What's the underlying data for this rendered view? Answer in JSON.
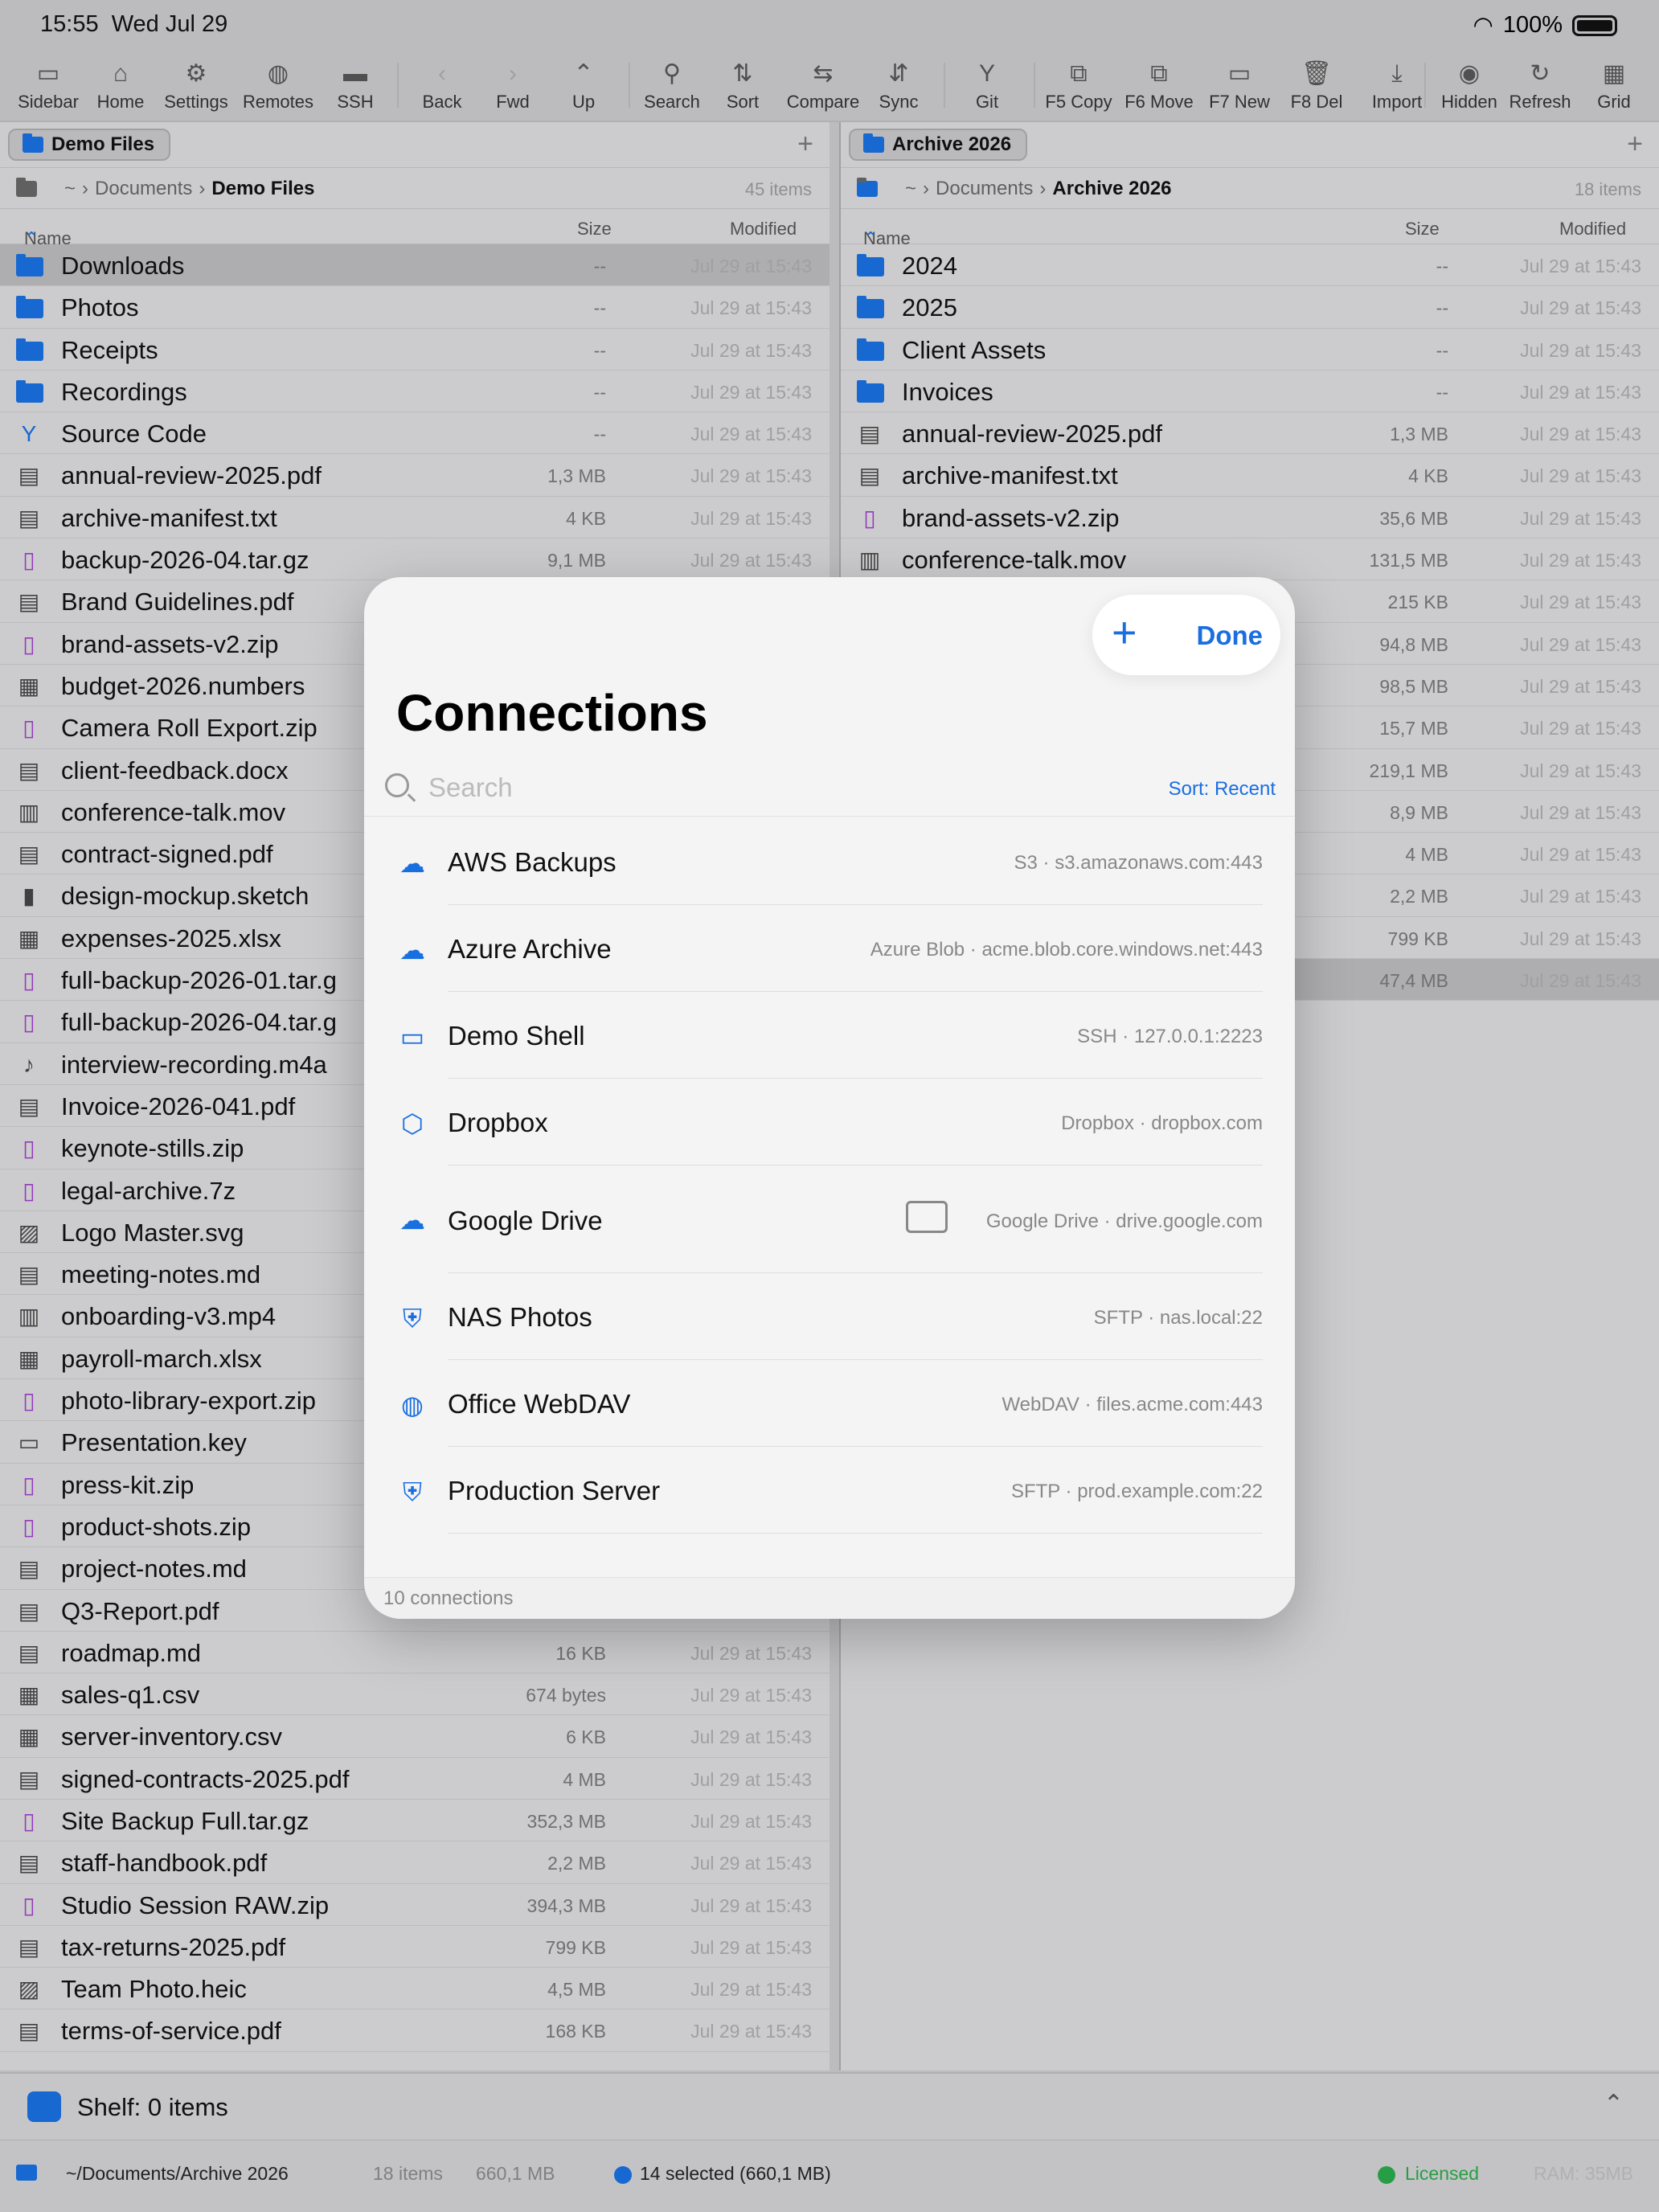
{
  "status": {
    "time": "15:55",
    "date": "Wed Jul 29",
    "battery": "100%"
  },
  "toolbar": [
    {
      "label": "Sidebar",
      "icon": "sidebar-icon",
      "glyph": "▭"
    },
    {
      "label": "Home",
      "icon": "home-icon",
      "glyph": "⌂"
    },
    {
      "label": "Settings",
      "icon": "gear-icon",
      "glyph": "⚙"
    },
    {
      "label": "Remotes",
      "icon": "globe-icon",
      "glyph": "◍"
    },
    {
      "label": "SSH",
      "icon": "terminal-icon",
      "glyph": "▬"
    },
    {
      "label": "Back",
      "icon": "back-icon",
      "glyph": "‹"
    },
    {
      "label": "Fwd",
      "icon": "forward-icon",
      "glyph": "›"
    },
    {
      "label": "Up",
      "icon": "up-icon",
      "glyph": "⌃"
    },
    {
      "label": "Search",
      "icon": "search-icon",
      "glyph": "⚲"
    },
    {
      "label": "Sort",
      "icon": "sort-icon",
      "glyph": "⇅"
    },
    {
      "label": "Compare",
      "icon": "compare-icon",
      "glyph": "⇆"
    },
    {
      "label": "Sync",
      "icon": "sync-icon",
      "glyph": "⇵"
    },
    {
      "label": "Git",
      "icon": "git-icon",
      "glyph": "Y"
    },
    {
      "label": "F5 Copy",
      "icon": "copy-icon",
      "glyph": "⧉"
    },
    {
      "label": "F6 Move",
      "icon": "move-icon",
      "glyph": "⧉"
    },
    {
      "label": "F7 New",
      "icon": "new-folder-icon",
      "glyph": "▭"
    },
    {
      "label": "F8 Del",
      "icon": "trash-icon",
      "glyph": "🗑"
    },
    {
      "label": "Import",
      "icon": "import-icon",
      "glyph": "⤓"
    },
    {
      "label": "Hidden",
      "icon": "eye-slash-icon",
      "glyph": "◉"
    },
    {
      "label": "Refresh",
      "icon": "refresh-icon",
      "glyph": "↻"
    },
    {
      "label": "Grid",
      "icon": "grid-icon",
      "glyph": "▦"
    }
  ],
  "left": {
    "tab": "Demo Files",
    "crumbs": [
      "~",
      "Documents",
      "Demo Files"
    ],
    "count": "45 items",
    "cols": {
      "name": "Name",
      "size": "Size",
      "modified": "Modified"
    },
    "rows": [
      {
        "n": "Downloads",
        "s": "--",
        "m": "Jul 29 at 15:43",
        "t": "folder",
        "sel": true
      },
      {
        "n": "Photos",
        "s": "--",
        "m": "Jul 29 at 15:43",
        "t": "folder"
      },
      {
        "n": "Receipts",
        "s": "--",
        "m": "Jul 29 at 15:43",
        "t": "folder"
      },
      {
        "n": "Recordings",
        "s": "--",
        "m": "Jul 29 at 15:43",
        "t": "folder"
      },
      {
        "n": "Source Code",
        "s": "--",
        "m": "Jul 29 at 15:43",
        "t": "git"
      },
      {
        "n": "annual-review-2025.pdf",
        "s": "1,3 MB",
        "m": "Jul 29 at 15:43",
        "t": "pdf"
      },
      {
        "n": "archive-manifest.txt",
        "s": "4 KB",
        "m": "Jul 29 at 15:43",
        "t": "txt"
      },
      {
        "n": "backup-2026-04.tar.gz",
        "s": "9,1 MB",
        "m": "Jul 29 at 15:43",
        "t": "zip"
      },
      {
        "n": "Brand Guidelines.pdf",
        "s": "",
        "m": "",
        "t": "pdf"
      },
      {
        "n": "brand-assets-v2.zip",
        "s": "",
        "m": "",
        "t": "zip"
      },
      {
        "n": "budget-2026.numbers",
        "s": "",
        "m": "",
        "t": "sheet"
      },
      {
        "n": "Camera Roll Export.zip",
        "s": "",
        "m": "",
        "t": "zip"
      },
      {
        "n": "client-feedback.docx",
        "s": "",
        "m": "",
        "t": "doc"
      },
      {
        "n": "conference-talk.mov",
        "s": "",
        "m": "",
        "t": "video"
      },
      {
        "n": "contract-signed.pdf",
        "s": "",
        "m": "",
        "t": "pdf"
      },
      {
        "n": "design-mockup.sketch",
        "s": "",
        "m": "",
        "t": "file"
      },
      {
        "n": "expenses-2025.xlsx",
        "s": "",
        "m": "",
        "t": "sheet"
      },
      {
        "n": "full-backup-2026-01.tar.g",
        "s": "",
        "m": "",
        "t": "zip"
      },
      {
        "n": "full-backup-2026-04.tar.g",
        "s": "",
        "m": "",
        "t": "zip"
      },
      {
        "n": "interview-recording.m4a",
        "s": "",
        "m": "",
        "t": "audio"
      },
      {
        "n": "Invoice-2026-041.pdf",
        "s": "",
        "m": "",
        "t": "pdf"
      },
      {
        "n": "keynote-stills.zip",
        "s": "",
        "m": "",
        "t": "zip"
      },
      {
        "n": "legal-archive.7z",
        "s": "",
        "m": "",
        "t": "zip"
      },
      {
        "n": "Logo Master.svg",
        "s": "",
        "m": "",
        "t": "image"
      },
      {
        "n": "meeting-notes.md",
        "s": "",
        "m": "",
        "t": "txt"
      },
      {
        "n": "onboarding-v3.mp4",
        "s": "",
        "m": "",
        "t": "video"
      },
      {
        "n": "payroll-march.xlsx",
        "s": "",
        "m": "",
        "t": "sheet"
      },
      {
        "n": "photo-library-export.zip",
        "s": "",
        "m": "",
        "t": "zip"
      },
      {
        "n": "Presentation.key",
        "s": "",
        "m": "",
        "t": "slides"
      },
      {
        "n": "press-kit.zip",
        "s": "",
        "m": "",
        "t": "zip"
      },
      {
        "n": "product-shots.zip",
        "s": "",
        "m": "",
        "t": "zip"
      },
      {
        "n": "project-notes.md",
        "s": "",
        "m": "",
        "t": "txt"
      },
      {
        "n": "Q3-Report.pdf",
        "s": "",
        "m": "",
        "t": "pdf"
      },
      {
        "n": "roadmap.md",
        "s": "16 KB",
        "m": "Jul 29 at 15:43",
        "t": "txt"
      },
      {
        "n": "sales-q1.csv",
        "s": "674 bytes",
        "m": "Jul 29 at 15:43",
        "t": "sheet"
      },
      {
        "n": "server-inventory.csv",
        "s": "6 KB",
        "m": "Jul 29 at 15:43",
        "t": "sheet"
      },
      {
        "n": "signed-contracts-2025.pdf",
        "s": "4 MB",
        "m": "Jul 29 at 15:43",
        "t": "pdf"
      },
      {
        "n": "Site Backup Full.tar.gz",
        "s": "352,3 MB",
        "m": "Jul 29 at 15:43",
        "t": "zip"
      },
      {
        "n": "staff-handbook.pdf",
        "s": "2,2 MB",
        "m": "Jul 29 at 15:43",
        "t": "pdf"
      },
      {
        "n": "Studio Session RAW.zip",
        "s": "394,3 MB",
        "m": "Jul 29 at 15:43",
        "t": "zip"
      },
      {
        "n": "tax-returns-2025.pdf",
        "s": "799 KB",
        "m": "Jul 29 at 15:43",
        "t": "pdf"
      },
      {
        "n": "Team Photo.heic",
        "s": "4,5 MB",
        "m": "Jul 29 at 15:43",
        "t": "image"
      },
      {
        "n": "terms-of-service.pdf",
        "s": "168 KB",
        "m": "Jul 29 at 15:43",
        "t": "pdf"
      }
    ]
  },
  "right": {
    "tab": "Archive 2026",
    "crumbs": [
      "~",
      "Documents",
      "Archive 2026"
    ],
    "count": "18 items",
    "cols": {
      "name": "Name",
      "size": "Size",
      "modified": "Modified"
    },
    "rows": [
      {
        "n": "2024",
        "s": "--",
        "m": "Jul 29 at 15:43",
        "t": "folder"
      },
      {
        "n": "2025",
        "s": "--",
        "m": "Jul 29 at 15:43",
        "t": "folder"
      },
      {
        "n": "Client Assets",
        "s": "--",
        "m": "Jul 29 at 15:43",
        "t": "folder"
      },
      {
        "n": "Invoices",
        "s": "--",
        "m": "Jul 29 at 15:43",
        "t": "folder"
      },
      {
        "n": "annual-review-2025.pdf",
        "s": "1,3 MB",
        "m": "Jul 29 at 15:43",
        "t": "pdf"
      },
      {
        "n": "archive-manifest.txt",
        "s": "4 KB",
        "m": "Jul 29 at 15:43",
        "t": "txt"
      },
      {
        "n": "brand-assets-v2.zip",
        "s": "35,6 MB",
        "m": "Jul 29 at 15:43",
        "t": "zip"
      },
      {
        "n": "conference-talk.mov",
        "s": "131,5 MB",
        "m": "Jul 29 at 15:43",
        "t": "video"
      },
      {
        "n": "",
        "s": "215 KB",
        "m": "Jul 29 at 15:43",
        "t": ""
      },
      {
        "n": "",
        "s": "94,8 MB",
        "m": "Jul 29 at 15:43",
        "t": ""
      },
      {
        "n": "",
        "s": "98,5 MB",
        "m": "Jul 29 at 15:43",
        "t": ""
      },
      {
        "n": "",
        "s": "15,7 MB",
        "m": "Jul 29 at 15:43",
        "t": ""
      },
      {
        "n": "",
        "s": "219,1 MB",
        "m": "Jul 29 at 15:43",
        "t": ""
      },
      {
        "n": "",
        "s": "8,9 MB",
        "m": "Jul 29 at 15:43",
        "t": ""
      },
      {
        "n": "",
        "s": "4 MB",
        "m": "Jul 29 at 15:43",
        "t": ""
      },
      {
        "n": "",
        "s": "2,2 MB",
        "m": "Jul 29 at 15:43",
        "t": ""
      },
      {
        "n": "",
        "s": "799 KB",
        "m": "Jul 29 at 15:43",
        "t": ""
      },
      {
        "n": "",
        "s": "47,4 MB",
        "m": "Jul 29 at 15:43",
        "t": "",
        "sel": true
      }
    ]
  },
  "shelf": {
    "label": "Shelf: 0 items"
  },
  "statusbar": {
    "path": "~/Documents/Archive 2026",
    "items": "18 items",
    "size": "660,1 MB",
    "selected": "14 selected (660,1 MB)",
    "license": "Licensed",
    "ram": "RAM: 35MB"
  },
  "modal": {
    "title": "Connections",
    "done": "Done",
    "search_placeholder": "Search",
    "sort": "Sort: Recent",
    "footer": "10 connections",
    "connections": [
      {
        "name": "AWS Backups",
        "detail": "S3 · s3.amazonaws.com:443",
        "icon": "cloud-icon",
        "glyph": "☁"
      },
      {
        "name": "Azure Archive",
        "detail": "Azure Blob · acme.blob.core.windows.net:443",
        "icon": "cloud-filled-icon",
        "glyph": "☁"
      },
      {
        "name": "Demo Shell",
        "detail": "SSH · 127.0.0.1:2223",
        "icon": "terminal-icon",
        "glyph": "▭"
      },
      {
        "name": "Dropbox",
        "detail": "Dropbox · dropbox.com",
        "icon": "box-icon",
        "glyph": "⬡"
      },
      {
        "name": "Google Drive",
        "detail": "Google Drive · drive.google.com",
        "icon": "drive-icon",
        "glyph": "☁"
      },
      {
        "name": "NAS Photos",
        "detail": "SFTP · nas.local:22",
        "icon": "shield-lock-icon",
        "glyph": "⛨"
      },
      {
        "name": "Office WebDAV",
        "detail": "WebDAV · files.acme.com:443",
        "icon": "globe-icon",
        "glyph": "◍"
      },
      {
        "name": "Production Server",
        "detail": "SFTP · prod.example.com:22",
        "icon": "shield-lock-icon",
        "glyph": "⛨"
      }
    ]
  }
}
